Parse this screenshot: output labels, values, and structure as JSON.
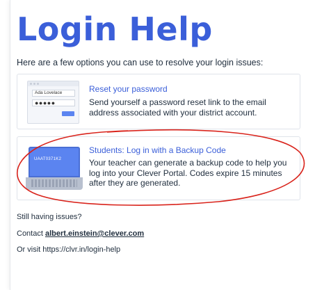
{
  "page": {
    "title": "Login Help",
    "intro": "Here are a few options you can use to resolve your login issues:"
  },
  "options": [
    {
      "title": "Reset your password",
      "description": "Send yourself a password reset link to the email address associated with your district account.",
      "illustration": {
        "username": "Ada Lovelace",
        "password_mask": "●●●●●"
      }
    },
    {
      "title": "Students: Log in with a Backup Code",
      "description": "Your teacher can generate a backup code to help you log into your Clever Portal. Codes expire 15 minutes after they are generated.",
      "illustration": {
        "code": "UAAT0371K2"
      }
    }
  ],
  "footer": {
    "still_text": "Still having issues?",
    "contact_prefix": "Contact",
    "contact_email": "albert.einstein@clever.com",
    "visit_text": "Or visit https://clvr.in/login-help"
  },
  "colors": {
    "brand_blue": "#3b5fd9",
    "annotation_red": "#d9231b"
  }
}
